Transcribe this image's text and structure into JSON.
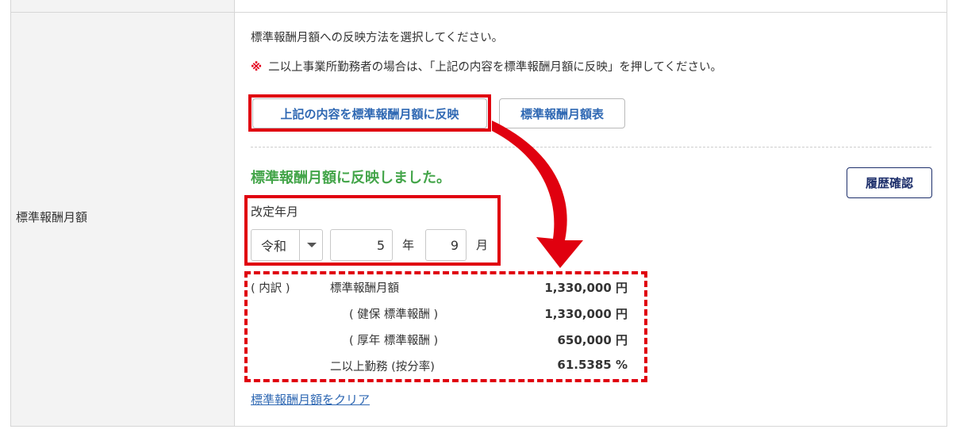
{
  "field_label": "標準報酬月額",
  "instruction": "標準報酬月額への反映方法を選択してください。",
  "note": {
    "mark": "※",
    "text": "二以上事業所勤務者の場合は、「上記の内容を標準報酬月額に反映」を押してください。"
  },
  "buttons": {
    "reflect": "上記の内容を標準報酬月額に反映",
    "table": "標準報酬月額表",
    "history": "履歴確認"
  },
  "status_message": "標準報酬月額に反映しました。",
  "revision": {
    "label": "改定年月",
    "era": "令和",
    "year": "5",
    "year_unit": "年",
    "month": "9",
    "month_unit": "月"
  },
  "breakdown": {
    "prefix": "( 内訳 )",
    "rows": [
      {
        "label": "標準報酬月額",
        "value": "1,330,000 円"
      },
      {
        "label": "( 健保 標準報酬 )",
        "value": "1,330,000 円"
      },
      {
        "label": "( 厚年 標準報酬 )",
        "value": "650,000 円"
      },
      {
        "label": "二以上勤務 (按分率)",
        "value": "61.5385 %"
      }
    ]
  },
  "clear_link": "標準報酬月額をクリア",
  "colors": {
    "highlight": "#e0000f",
    "success": "#44a54a",
    "link": "#2f68b3"
  }
}
